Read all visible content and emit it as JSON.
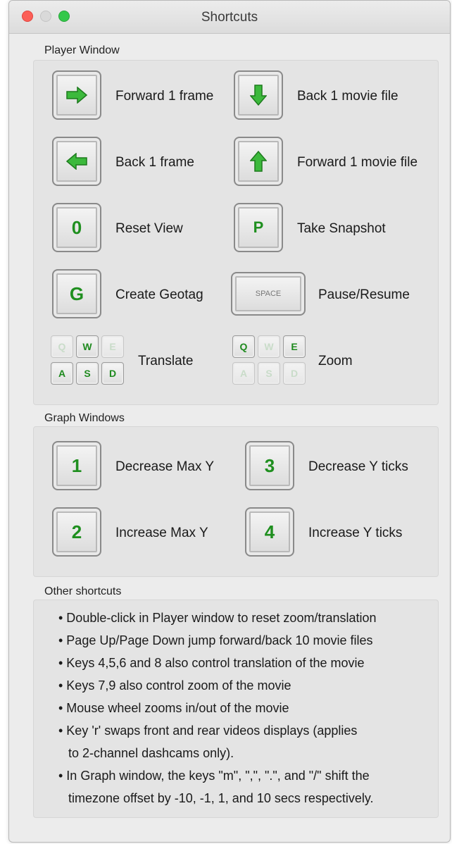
{
  "window": {
    "title": "Shortcuts"
  },
  "player": {
    "label": "Player Window",
    "shortcuts": [
      {
        "key": "right-arrow",
        "label": "Forward 1 frame"
      },
      {
        "key": "down-arrow",
        "label": "Back 1 movie file"
      },
      {
        "key": "left-arrow",
        "label": "Back 1 frame"
      },
      {
        "key": "up-arrow",
        "label": "Forward 1 movie file"
      },
      {
        "key": "0",
        "label": "Reset View"
      },
      {
        "key": "P",
        "label": "Take Snapshot"
      },
      {
        "key": "G",
        "label": "Create Geotag"
      },
      {
        "key": "SPACE",
        "label": "Pause/Resume"
      }
    ],
    "translate": {
      "label": "Translate",
      "keys": [
        "Q",
        "W",
        "E",
        "A",
        "S",
        "D"
      ]
    },
    "zoom": {
      "label": "Zoom",
      "keys": [
        "Q",
        "W",
        "E",
        "A",
        "S",
        "D"
      ]
    }
  },
  "graph": {
    "label": "Graph Windows",
    "shortcuts": [
      {
        "key": "1",
        "label": "Decrease Max Y"
      },
      {
        "key": "3",
        "label": "Decrease Y ticks"
      },
      {
        "key": "2",
        "label": "Increase Max Y"
      },
      {
        "key": "4",
        "label": "Increase Y ticks"
      }
    ]
  },
  "other": {
    "label": "Other shortcuts",
    "lines": [
      "• Double-click in Player window to reset zoom/translation",
      "• Page Up/Page Down jump forward/back 10 movie files",
      "• Keys 4,5,6 and 8 also control translation of the movie",
      "• Keys 7,9 also control zoom of the movie",
      "• Mouse wheel zooms in/out of the movie",
      "• Key 'r' swaps front and rear videos displays (applies",
      "to 2-channel dashcams only).",
      "• In Graph window, the keys \"m\", \",\", \".\", and \"/\" shift the",
      "timezone offset by -10, -1, 1, and 10 secs respectively."
    ]
  },
  "colors": {
    "key_green": "#1f8f1f",
    "arrow_green": "#3cb93c"
  }
}
